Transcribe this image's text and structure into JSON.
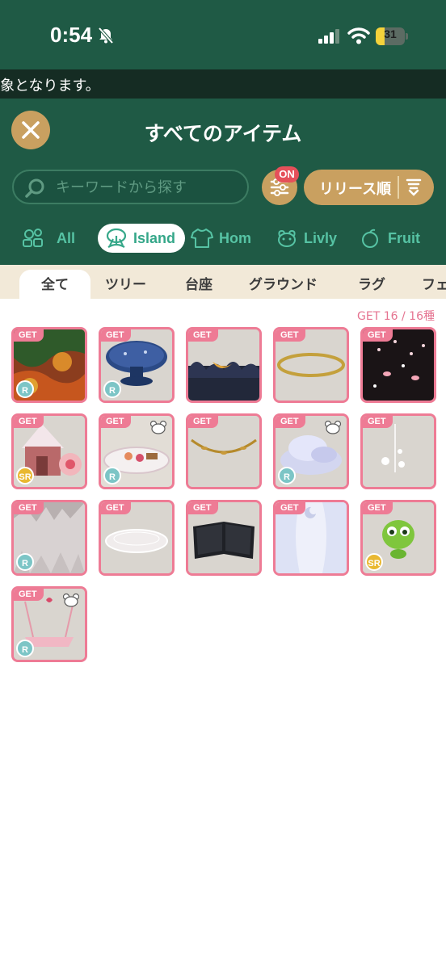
{
  "status_bar": {
    "time": "0:54",
    "battery": "31",
    "battery_level": 0.31
  },
  "ticker": {
    "text": "象となります。"
  },
  "header": {
    "title": "すべてのアイテム",
    "search_placeholder": "キーワードから探す",
    "filter_badge": "ON",
    "sort_label": "リリース順"
  },
  "categories": [
    {
      "label": "All",
      "icon": "all-icon",
      "active": false
    },
    {
      "label": "Island",
      "icon": "island-icon",
      "active": true
    },
    {
      "label": "Hom",
      "icon": "shirt-icon",
      "active": false
    },
    {
      "label": "Livly",
      "icon": "livly-icon",
      "active": false
    },
    {
      "label": "Fruit",
      "icon": "fruit-icon",
      "active": false
    }
  ],
  "subtabs": [
    "全て",
    "ツリー",
    "台座",
    "グラウンド",
    "ラグ",
    "フェ"
  ],
  "get_count": "GET 16 / 16種",
  "get_tag": "GET",
  "items": [
    {
      "name": "autumn-forest-ground",
      "rarity": "R",
      "bear": false
    },
    {
      "name": "blue-pedestal",
      "rarity": "R",
      "bear": false
    },
    {
      "name": "dark-moon-ground",
      "rarity": "",
      "bear": false
    },
    {
      "name": "gold-ring",
      "rarity": "",
      "bear": false
    },
    {
      "name": "night-lanterns",
      "rarity": "",
      "bear": false
    },
    {
      "name": "gingerbread-house",
      "rarity": "SR",
      "bear": false
    },
    {
      "name": "sweets-plate",
      "rarity": "R",
      "bear": true
    },
    {
      "name": "golden-garland",
      "rarity": "",
      "bear": false
    },
    {
      "name": "cloud-bed",
      "rarity": "R",
      "bear": true
    },
    {
      "name": "sparkle-drops",
      "rarity": "",
      "bear": false
    },
    {
      "name": "crystal-cave",
      "rarity": "R",
      "bear": false
    },
    {
      "name": "lace-platform",
      "rarity": "",
      "bear": false
    },
    {
      "name": "black-book",
      "rarity": "",
      "bear": false
    },
    {
      "name": "moon-curtain",
      "rarity": "",
      "bear": false
    },
    {
      "name": "green-creature",
      "rarity": "SR",
      "bear": false
    },
    {
      "name": "pink-swing",
      "rarity": "R",
      "bear": true
    }
  ],
  "colors": {
    "header_green": "#1f5a45",
    "gold": "#c9a060",
    "pink": "#ee7b95",
    "mint": "#56c3a4"
  }
}
